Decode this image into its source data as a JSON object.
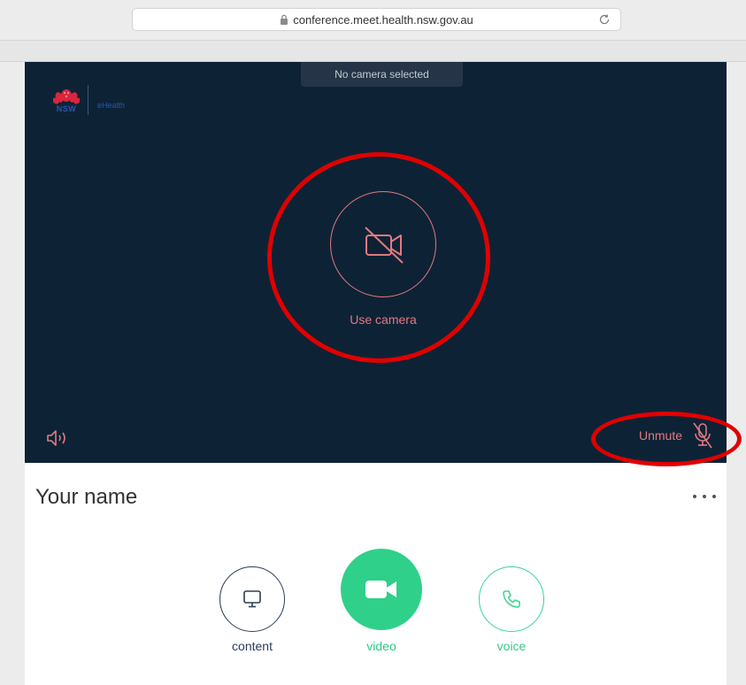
{
  "browser": {
    "url": "conference.meet.health.nsw.gov.au"
  },
  "logo": {
    "brand": "NSW",
    "product": "eHealth"
  },
  "video": {
    "camera_status": "No camera selected",
    "use_camera_label": "Use camera",
    "unmute_label": "Unmute"
  },
  "participant": {
    "name": "Your name"
  },
  "controls": {
    "content_label": "content",
    "video_label": "video",
    "voice_label": "voice"
  },
  "icons": {
    "lock": "lock-icon",
    "reload": "reload-icon",
    "camera_off": "camera-off-icon",
    "speaker": "speaker-icon",
    "mic_off": "mic-off-icon",
    "more": "more-icon",
    "monitor": "monitor-icon",
    "video_camera": "video-camera-icon",
    "phone": "phone-icon"
  },
  "colors": {
    "video_bg": "#0e2236",
    "accent_red": "#e07a80",
    "accent_green": "#2fd08a",
    "annotation": "#e00000"
  }
}
